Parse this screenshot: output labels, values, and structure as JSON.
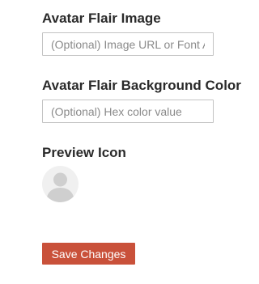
{
  "flair_image": {
    "label": "Avatar Flair Image",
    "placeholder": "(Optional) Image URL or Font Awesome Icon",
    "value": ""
  },
  "flair_background": {
    "label": "Avatar Flair Background Color",
    "placeholder": "(Optional) Hex color value",
    "value": ""
  },
  "preview": {
    "label": "Preview Icon",
    "icon": "default-user-avatar-icon"
  },
  "actions": {
    "save_label": "Save Changes"
  },
  "colors": {
    "button_background": "#c9513a",
    "button_text": "#ffffff",
    "label_text": "#2a2a2a",
    "avatar_background": "#f0f0f0",
    "avatar_silhouette": "#cfcfcf"
  }
}
